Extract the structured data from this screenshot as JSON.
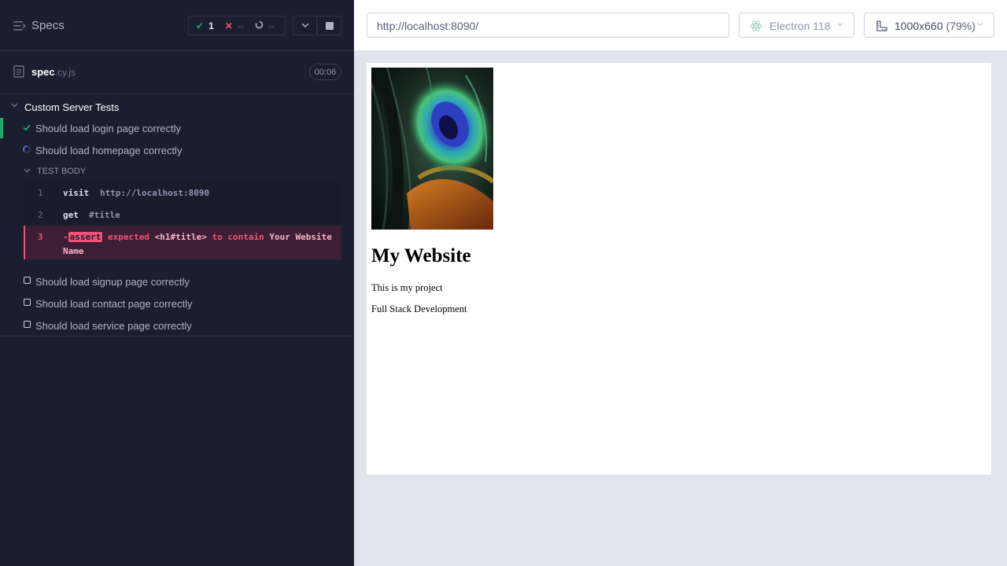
{
  "runner": {
    "header": {
      "title": "Specs",
      "stats": {
        "passed": "1",
        "failed": "--",
        "pending": "--"
      }
    },
    "spec": {
      "base": "spec",
      "ext": ".cy.js",
      "duration": "00:06"
    },
    "suite": {
      "title": "Custom Server Tests",
      "tests": [
        {
          "title": "Should load login page correctly",
          "state": "passed"
        },
        {
          "title": "Should load homepage correctly",
          "state": "running"
        },
        {
          "title": "Should load signup page correctly",
          "state": "pending"
        },
        {
          "title": "Should load contact page correctly",
          "state": "pending"
        },
        {
          "title": "Should load service page correctly",
          "state": "pending"
        }
      ],
      "test_body_label": "TEST BODY",
      "commands": [
        {
          "num": "1",
          "name": "visit",
          "message": "http://localhost:8090"
        },
        {
          "num": "2",
          "name": "get",
          "message": "#title"
        },
        {
          "num": "3",
          "dash": "-",
          "name": "assert",
          "message": {
            "w1": "expected",
            "w2": "<h1#title>",
            "w3": "to contain",
            "w4": "Your",
            "w5": "Website Name"
          }
        }
      ]
    }
  },
  "preview": {
    "url": "http://localhost:8090/",
    "browser": "Electron 118",
    "viewport": {
      "size": "1000x660",
      "scale": "(79%)"
    },
    "page": {
      "title": "My Website",
      "p1": "This is my project",
      "p2": "Full Stack Development"
    }
  },
  "colors": {
    "pass": "#1fa971",
    "fail": "#f15278",
    "panel": "#1b1e2e",
    "running": "#6470f3"
  }
}
